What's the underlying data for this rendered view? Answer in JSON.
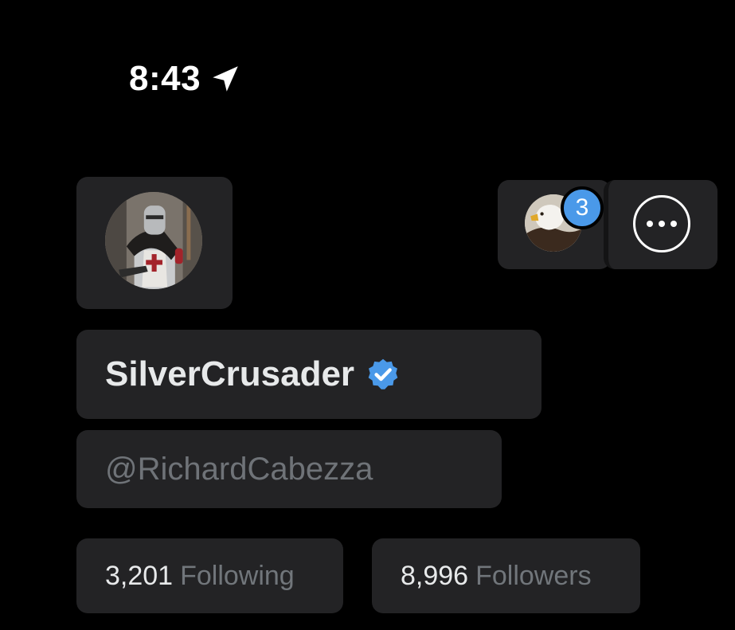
{
  "status_bar": {
    "time": "8:43",
    "location_icon": "location-arrow-icon"
  },
  "profile": {
    "display_name": "SilverCrusader",
    "verified": true,
    "verified_color": "#4a99e9",
    "handle": "@RichardCabezza",
    "avatar": "knight-avatar"
  },
  "subscriptions": {
    "avatar": "eagle-avatar",
    "badge_count": "3",
    "badge_color": "#4a99e9"
  },
  "actions": {
    "more_icon": "more-options-icon"
  },
  "stats": {
    "following_count": "3,201",
    "following_label": "Following",
    "followers_count": "8,996",
    "followers_label": "Followers"
  },
  "colors": {
    "background": "#000000",
    "tile": "#232325",
    "primary_text": "#e7e9ea",
    "secondary_text": "#71767b"
  }
}
